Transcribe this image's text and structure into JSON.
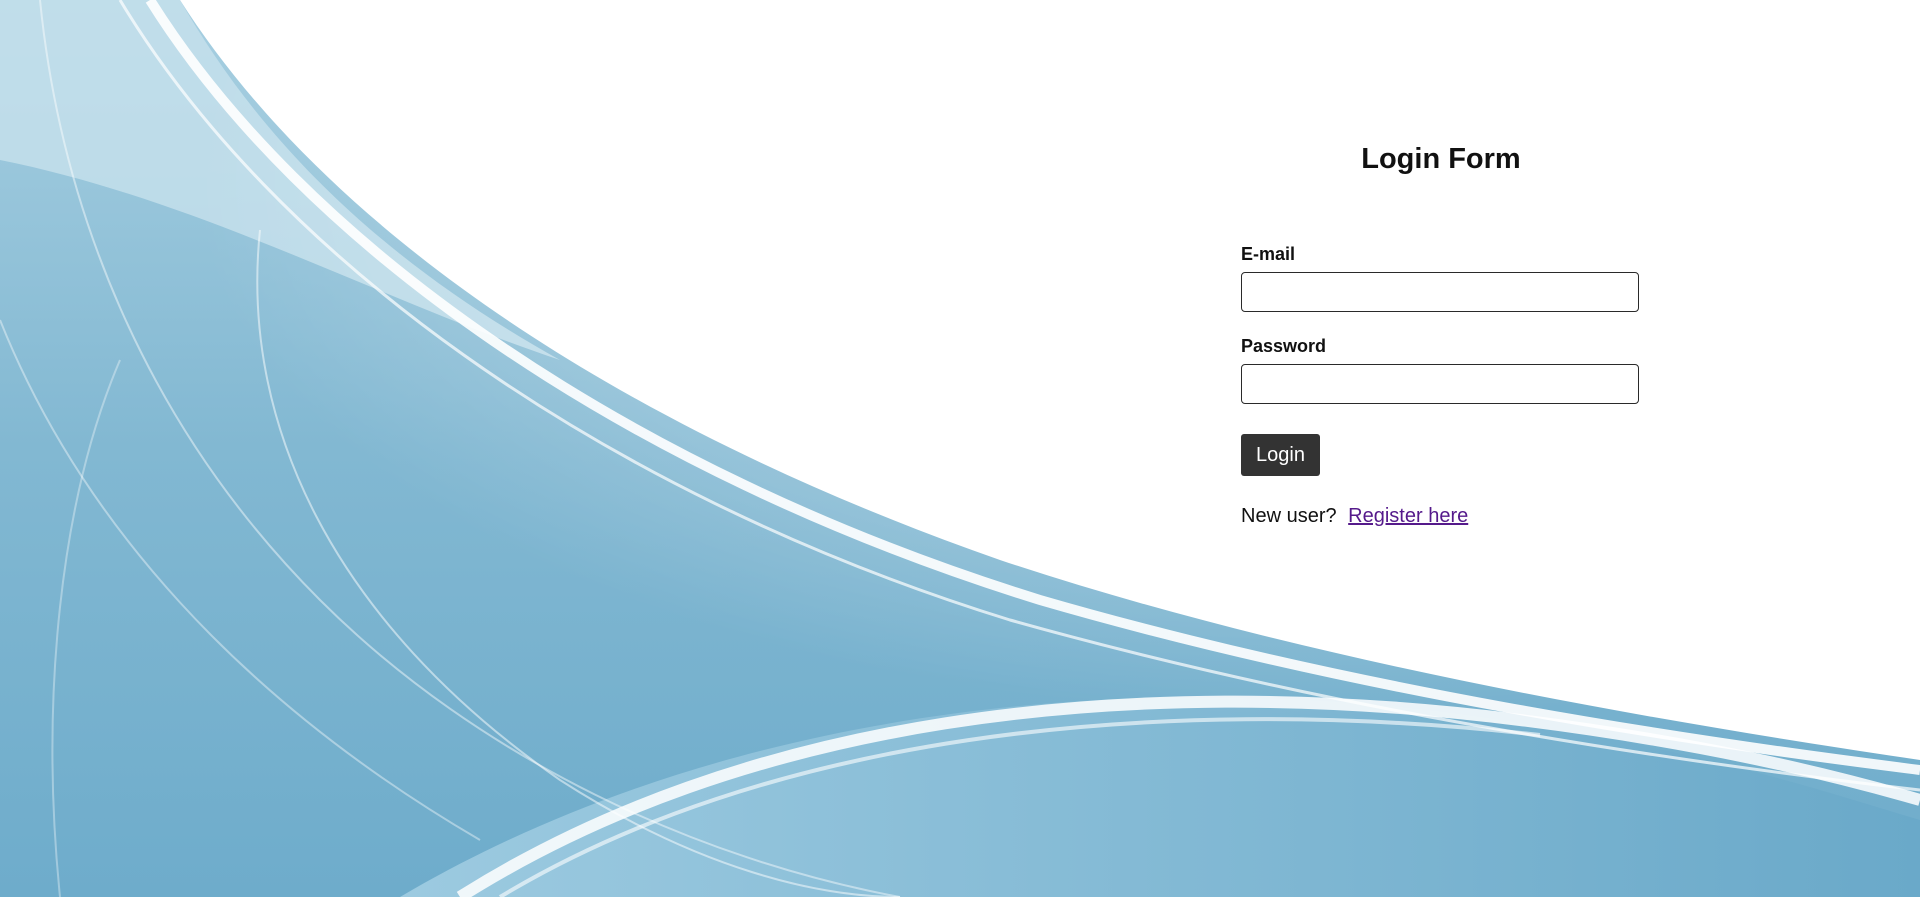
{
  "colors": {
    "background_top": "#ffffff",
    "background_wave": "#74aecb",
    "button_bg": "#333333",
    "button_text": "#ffffff",
    "link": "#551a8b"
  },
  "form": {
    "title": "Login Form",
    "email_label": "E-mail",
    "email_value": "",
    "password_label": "Password",
    "password_value": "",
    "login_button": "Login",
    "new_user_text": "New user?",
    "register_link": "Register here"
  }
}
